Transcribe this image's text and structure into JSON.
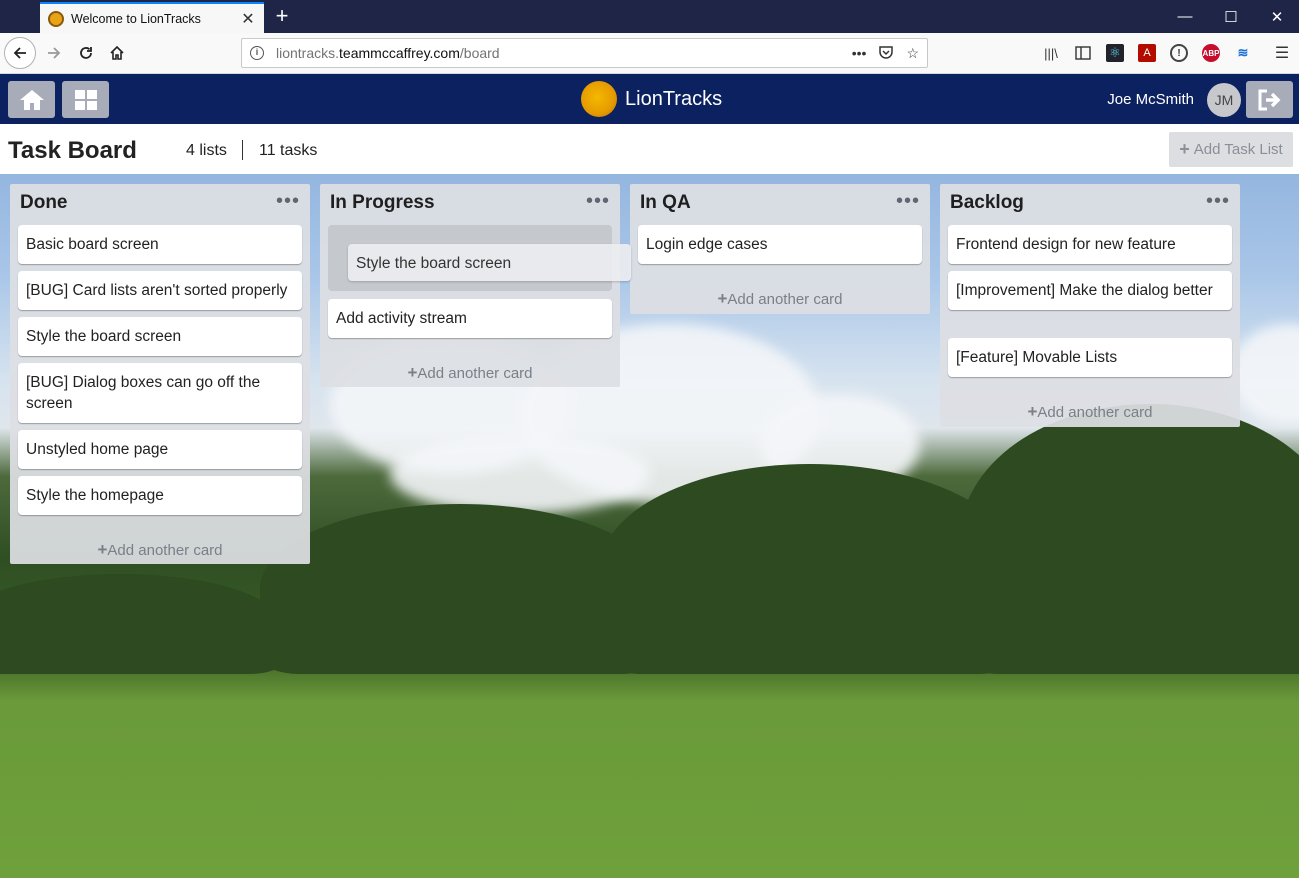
{
  "browser": {
    "tab_title": "Welcome to LionTracks",
    "url_domain_prefix": "liontracks.",
    "url_domain": "teammccaffrey.com",
    "url_path": "/board",
    "url_dots": "•••"
  },
  "header": {
    "brand": "LionTracks",
    "user_name": "Joe McSmith",
    "avatar_initials": "JM"
  },
  "board": {
    "title": "Task Board",
    "lists_count": "4 lists",
    "tasks_count": "11 tasks",
    "add_list_label": "Add Task List"
  },
  "add_card_label": "Add another card",
  "lists": [
    {
      "title": "Done",
      "cards": [
        "Basic board screen",
        "[BUG] Card lists aren't sorted properly",
        "Style the board screen",
        "[BUG] Dialog boxes can go off the screen",
        "Unstyled home page",
        "Style the homepage"
      ]
    },
    {
      "title": "In Progress",
      "cards": [
        "Add activity stream"
      ]
    },
    {
      "title": "In QA",
      "cards": [
        "Login edge cases"
      ]
    },
    {
      "title": "Backlog",
      "cards": [
        "Frontend design for new feature",
        "[Improvement] Make the dialog better",
        "[Feature] Movable Lists"
      ]
    }
  ],
  "dragging_card": "Style the board screen",
  "icons": {
    "list_menu": "•••",
    "add": "+"
  }
}
